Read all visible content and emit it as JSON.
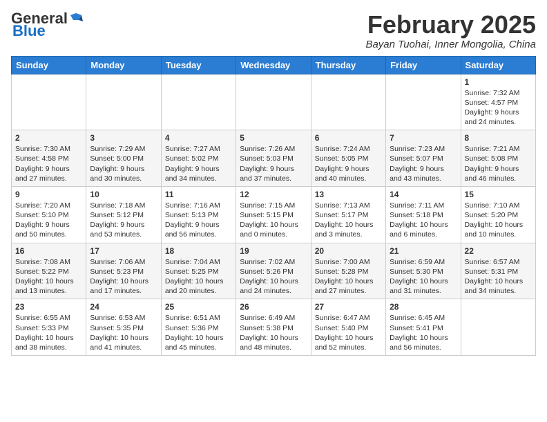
{
  "header": {
    "logo_general": "General",
    "logo_blue": "Blue",
    "month_title": "February 2025",
    "location": "Bayan Tuohai, Inner Mongolia, China"
  },
  "weekdays": [
    "Sunday",
    "Monday",
    "Tuesday",
    "Wednesday",
    "Thursday",
    "Friday",
    "Saturday"
  ],
  "weeks": [
    [
      {
        "day": "",
        "info": ""
      },
      {
        "day": "",
        "info": ""
      },
      {
        "day": "",
        "info": ""
      },
      {
        "day": "",
        "info": ""
      },
      {
        "day": "",
        "info": ""
      },
      {
        "day": "",
        "info": ""
      },
      {
        "day": "1",
        "info": "Sunrise: 7:32 AM\nSunset: 4:57 PM\nDaylight: 9 hours and 24 minutes."
      }
    ],
    [
      {
        "day": "2",
        "info": "Sunrise: 7:30 AM\nSunset: 4:58 PM\nDaylight: 9 hours and 27 minutes."
      },
      {
        "day": "3",
        "info": "Sunrise: 7:29 AM\nSunset: 5:00 PM\nDaylight: 9 hours and 30 minutes."
      },
      {
        "day": "4",
        "info": "Sunrise: 7:27 AM\nSunset: 5:02 PM\nDaylight: 9 hours and 34 minutes."
      },
      {
        "day": "5",
        "info": "Sunrise: 7:26 AM\nSunset: 5:03 PM\nDaylight: 9 hours and 37 minutes."
      },
      {
        "day": "6",
        "info": "Sunrise: 7:24 AM\nSunset: 5:05 PM\nDaylight: 9 hours and 40 minutes."
      },
      {
        "day": "7",
        "info": "Sunrise: 7:23 AM\nSunset: 5:07 PM\nDaylight: 9 hours and 43 minutes."
      },
      {
        "day": "8",
        "info": "Sunrise: 7:21 AM\nSunset: 5:08 PM\nDaylight: 9 hours and 46 minutes."
      }
    ],
    [
      {
        "day": "9",
        "info": "Sunrise: 7:20 AM\nSunset: 5:10 PM\nDaylight: 9 hours and 50 minutes."
      },
      {
        "day": "10",
        "info": "Sunrise: 7:18 AM\nSunset: 5:12 PM\nDaylight: 9 hours and 53 minutes."
      },
      {
        "day": "11",
        "info": "Sunrise: 7:16 AM\nSunset: 5:13 PM\nDaylight: 9 hours and 56 minutes."
      },
      {
        "day": "12",
        "info": "Sunrise: 7:15 AM\nSunset: 5:15 PM\nDaylight: 10 hours and 0 minutes."
      },
      {
        "day": "13",
        "info": "Sunrise: 7:13 AM\nSunset: 5:17 PM\nDaylight: 10 hours and 3 minutes."
      },
      {
        "day": "14",
        "info": "Sunrise: 7:11 AM\nSunset: 5:18 PM\nDaylight: 10 hours and 6 minutes."
      },
      {
        "day": "15",
        "info": "Sunrise: 7:10 AM\nSunset: 5:20 PM\nDaylight: 10 hours and 10 minutes."
      }
    ],
    [
      {
        "day": "16",
        "info": "Sunrise: 7:08 AM\nSunset: 5:22 PM\nDaylight: 10 hours and 13 minutes."
      },
      {
        "day": "17",
        "info": "Sunrise: 7:06 AM\nSunset: 5:23 PM\nDaylight: 10 hours and 17 minutes."
      },
      {
        "day": "18",
        "info": "Sunrise: 7:04 AM\nSunset: 5:25 PM\nDaylight: 10 hours and 20 minutes."
      },
      {
        "day": "19",
        "info": "Sunrise: 7:02 AM\nSunset: 5:26 PM\nDaylight: 10 hours and 24 minutes."
      },
      {
        "day": "20",
        "info": "Sunrise: 7:00 AM\nSunset: 5:28 PM\nDaylight: 10 hours and 27 minutes."
      },
      {
        "day": "21",
        "info": "Sunrise: 6:59 AM\nSunset: 5:30 PM\nDaylight: 10 hours and 31 minutes."
      },
      {
        "day": "22",
        "info": "Sunrise: 6:57 AM\nSunset: 5:31 PM\nDaylight: 10 hours and 34 minutes."
      }
    ],
    [
      {
        "day": "23",
        "info": "Sunrise: 6:55 AM\nSunset: 5:33 PM\nDaylight: 10 hours and 38 minutes."
      },
      {
        "day": "24",
        "info": "Sunrise: 6:53 AM\nSunset: 5:35 PM\nDaylight: 10 hours and 41 minutes."
      },
      {
        "day": "25",
        "info": "Sunrise: 6:51 AM\nSunset: 5:36 PM\nDaylight: 10 hours and 45 minutes."
      },
      {
        "day": "26",
        "info": "Sunrise: 6:49 AM\nSunset: 5:38 PM\nDaylight: 10 hours and 48 minutes."
      },
      {
        "day": "27",
        "info": "Sunrise: 6:47 AM\nSunset: 5:40 PM\nDaylight: 10 hours and 52 minutes."
      },
      {
        "day": "28",
        "info": "Sunrise: 6:45 AM\nSunset: 5:41 PM\nDaylight: 10 hours and 56 minutes."
      },
      {
        "day": "",
        "info": ""
      }
    ]
  ]
}
